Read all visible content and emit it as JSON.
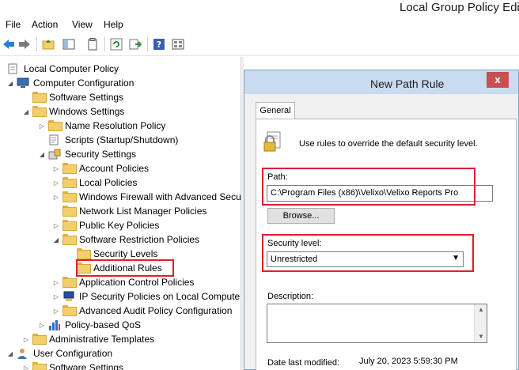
{
  "window": {
    "title": "Local Group Policy Edit"
  },
  "menu": {
    "file": "File",
    "action": "Action",
    "view": "View",
    "help": "Help"
  },
  "toolbar": {
    "icons": [
      "back-arrow-icon",
      "forward-arrow-icon",
      "up-folder-icon",
      "show-hide-tree-icon",
      "properties-icon",
      "refresh-icon",
      "export-icon",
      "help-icon",
      "view-icon"
    ]
  },
  "tree": {
    "local_policy": "Local Computer Policy",
    "computer_config": "Computer Configuration",
    "software_settings": "Software Settings",
    "windows_settings": "Windows Settings",
    "name_resolution": "Name Resolution Policy",
    "scripts": "Scripts (Startup/Shutdown)",
    "security_settings": "Security Settings",
    "account_policies": "Account Policies",
    "local_policies": "Local Policies",
    "firewall": "Windows Firewall with Advanced Secu",
    "network_list": "Network List Manager Policies",
    "public_key": "Public Key Policies",
    "srp": "Software Restriction Policies",
    "security_levels": "Security Levels",
    "additional_rules": "Additional Rules",
    "app_control": "Application Control Policies",
    "ip_security": "IP Security Policies on Local Compute",
    "audit_policy": "Advanced Audit Policy Configuration",
    "qos": "Policy-based QoS",
    "admin_templates": "Administrative Templates",
    "user_config": "User Configuration",
    "user_software_settings": "Software Settings"
  },
  "dialog": {
    "title": "New Path Rule",
    "close": "x",
    "tab_general": "General",
    "intro": "Use rules to override the default security level.",
    "path_label": "Path:",
    "path_value": "C:\\Program Files (x86)\\Velixo\\Velixo Reports Pro",
    "browse": "Browse...",
    "security_level_label": "Security level:",
    "security_level_value": "Unrestricted",
    "description_label": "Description:",
    "date_label": "Date last modified:",
    "date_value": "July 20, 2023   5:59:30 PM"
  },
  "colors": {
    "highlight_box": "#e01d2d",
    "dialog_header": "#c9dcef",
    "close_button": "#c75050"
  }
}
